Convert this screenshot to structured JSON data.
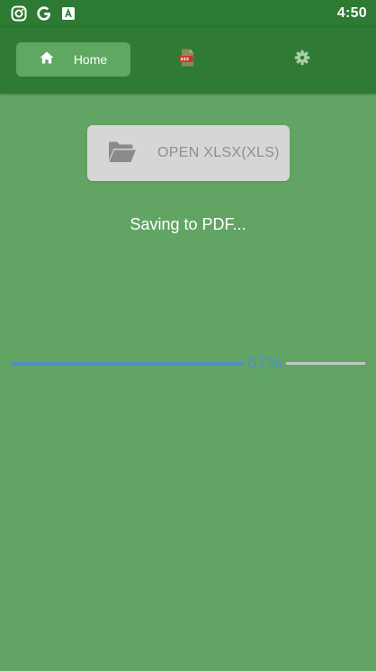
{
  "status_bar": {
    "time": "4:50",
    "icons": [
      "instagram-icon",
      "google-icon",
      "a-app-icon"
    ]
  },
  "nav": {
    "home_label": "Home",
    "tabs": [
      {
        "name": "home",
        "icon": "home-icon",
        "selected": true
      },
      {
        "name": "pdf",
        "icon": "pdf-file-icon",
        "selected": false
      },
      {
        "name": "settings",
        "icon": "gear-icon",
        "selected": false
      }
    ]
  },
  "main": {
    "open_button_label": "OPEN XLSX(XLS)",
    "status_message": "Saving to PDF...",
    "progress_label": "67%",
    "progress_value": 0.67
  },
  "colors": {
    "background": "#62a464",
    "app_bar": "#2f7b35",
    "selected_tab": "#5fa862",
    "progress": "#4f8fc8",
    "button": "#d6d6d6"
  }
}
